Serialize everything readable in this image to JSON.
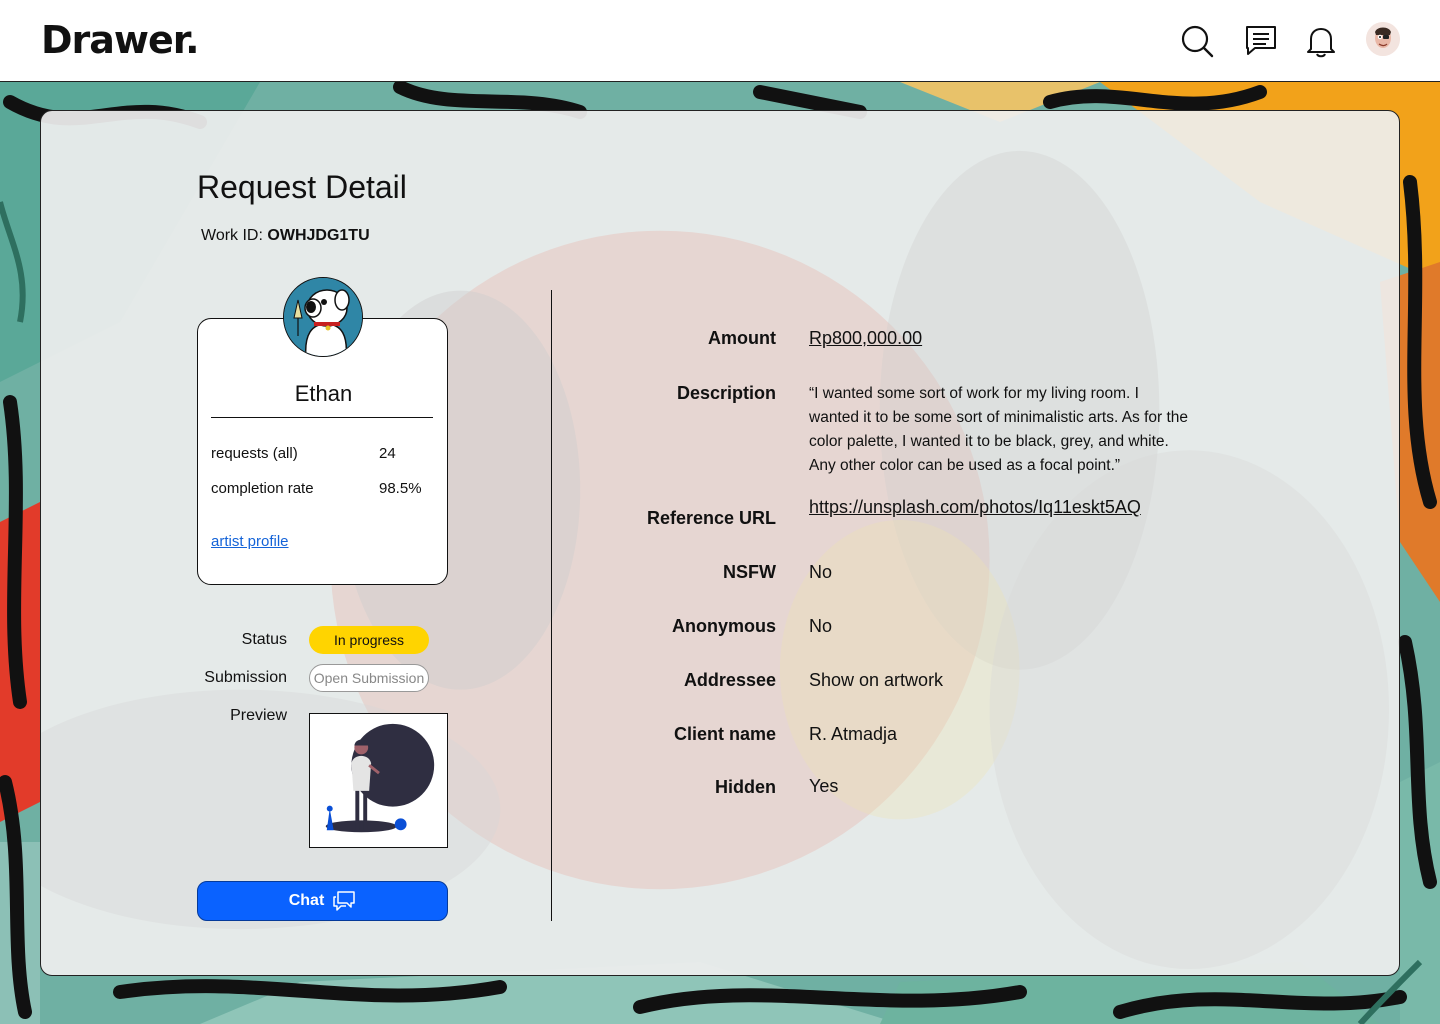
{
  "header": {
    "logo": "Drawer.",
    "icons": [
      "search-icon",
      "messages-icon",
      "bell-icon",
      "user-avatar"
    ]
  },
  "page": {
    "title": "Request Detail",
    "work_id_label": "Work ID:",
    "work_id_value": "OWHJDG1TU"
  },
  "artist": {
    "name": "Ethan",
    "stats": [
      {
        "label": "requests (all)",
        "value": "24"
      },
      {
        "label": "completion rate",
        "value": "98.5%"
      }
    ],
    "profile_link": "artist profile"
  },
  "side": {
    "status_label": "Status",
    "status_value": "In progress",
    "submission_label": "Submission",
    "submission_button": "Open Submission",
    "preview_label": "Preview",
    "chat_button": "Chat"
  },
  "details": [
    {
      "label": "Amount",
      "value": "Rp800,000.00"
    },
    {
      "label": "Description",
      "value": "“I wanted some sort of work for my living room. I wanted it to be some sort of minimalistic arts. As for the color palette, I wanted it to be black, grey, and white. Any other color can be used as a focal point.”"
    },
    {
      "label": "Reference URL",
      "value": "https://unsplash.com/photos/Iq11eskt5AQ"
    },
    {
      "label": "NSFW",
      "value": "No"
    },
    {
      "label": "Anonymous",
      "value": "No"
    },
    {
      "label": "Addressee",
      "value": "Show on artwork"
    },
    {
      "label": "Client name",
      "value": "R. Atmadja"
    },
    {
      "label": "Hidden",
      "value": "Yes"
    }
  ],
  "colors": {
    "status_badge": "#ffd400",
    "chat_button": "#0a62ff",
    "link": "#1463d8",
    "panel": "#eeeeee"
  }
}
